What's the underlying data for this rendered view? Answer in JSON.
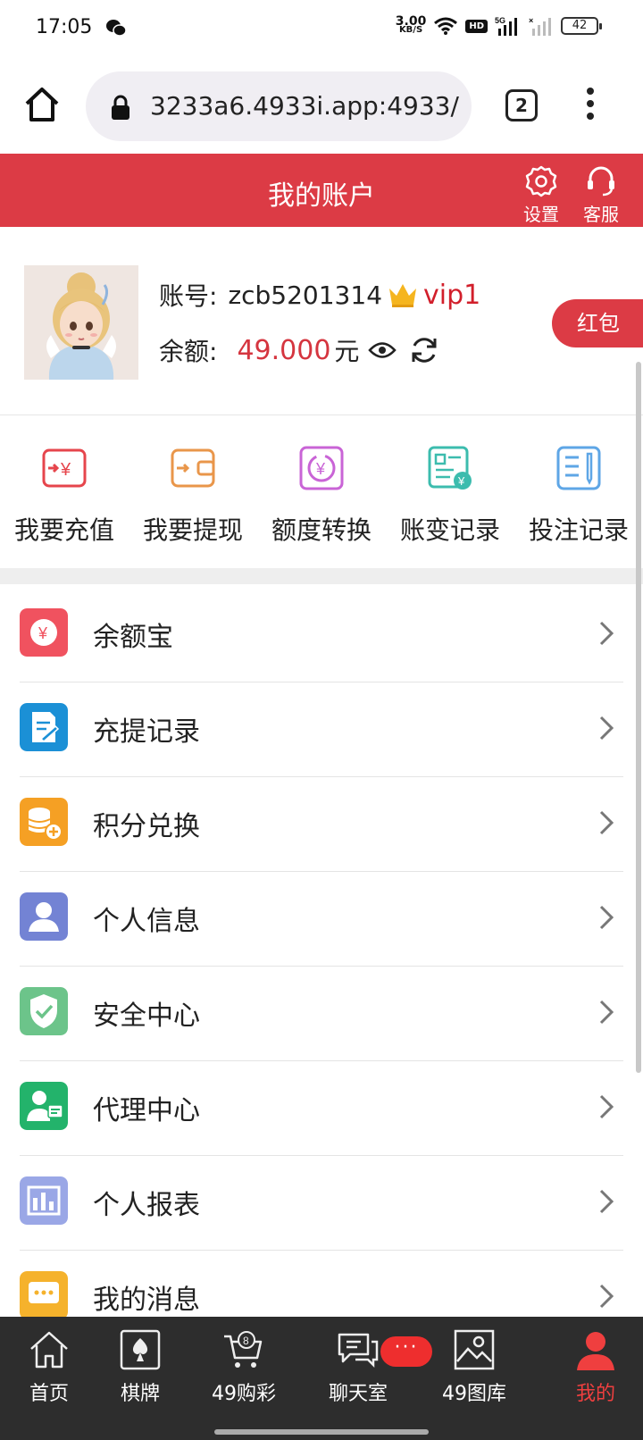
{
  "status_bar": {
    "time": "17:05",
    "speed_value": "3.00",
    "speed_unit": "KB/S",
    "hd_label": "HD",
    "network": "5G",
    "battery": "42"
  },
  "browser": {
    "url": "3233a6.4933i.app:4933/",
    "tab_count": "2"
  },
  "header": {
    "title": "我的账户",
    "settings_label": "设置",
    "service_label": "客服"
  },
  "profile": {
    "account_label": "账号:",
    "account_value": "zcb5201314",
    "vip": "vip1",
    "balance_label": "余额:",
    "balance_value": "49.000",
    "balance_unit": "元",
    "red_packet": "红包"
  },
  "quick_actions": [
    {
      "label": "我要充值",
      "icon": "recharge-icon",
      "color": "#e6454c"
    },
    {
      "label": "我要提现",
      "icon": "withdraw-icon",
      "color": "#e9964a"
    },
    {
      "label": "额度转换",
      "icon": "transfer-icon",
      "color": "#c964d6"
    },
    {
      "label": "账变记录",
      "icon": "account-change-icon",
      "color": "#3cbcae"
    },
    {
      "label": "投注记录",
      "icon": "bet-record-icon",
      "color": "#5ea6e6"
    }
  ],
  "menu": [
    {
      "label": "余额宝",
      "icon": "yuebao-icon",
      "color": "#f0525f"
    },
    {
      "label": "充提记录",
      "icon": "deposit-record-icon",
      "color": "#1b90d6"
    },
    {
      "label": "积分兑换",
      "icon": "points-exchange-icon",
      "color": "#f5a024"
    },
    {
      "label": "个人信息",
      "icon": "personal-info-icon",
      "color": "#7383d4"
    },
    {
      "label": "安全中心",
      "icon": "security-icon",
      "color": "#6cc48a"
    },
    {
      "label": "代理中心",
      "icon": "agent-icon",
      "color": "#23b36b"
    },
    {
      "label": "个人报表",
      "icon": "report-icon",
      "color": "#9aa7e6"
    },
    {
      "label": "我的消息",
      "icon": "message-icon",
      "color": "#f5b22c"
    }
  ],
  "bottom_nav": [
    {
      "label": "首页",
      "icon": "home-icon"
    },
    {
      "label": "棋牌",
      "icon": "cards-icon"
    },
    {
      "label": "49购彩",
      "icon": "cart-icon"
    },
    {
      "label": "聊天室",
      "icon": "chat-icon"
    },
    {
      "label": "49图库",
      "icon": "gallery-icon"
    },
    {
      "label": "我的",
      "icon": "user-icon",
      "active": true
    }
  ],
  "chat_badge": "···",
  "colors": {
    "brand_red": "#dc3b45",
    "nav_bg": "#2d2d2d",
    "active_nav": "#ef3f3f"
  }
}
